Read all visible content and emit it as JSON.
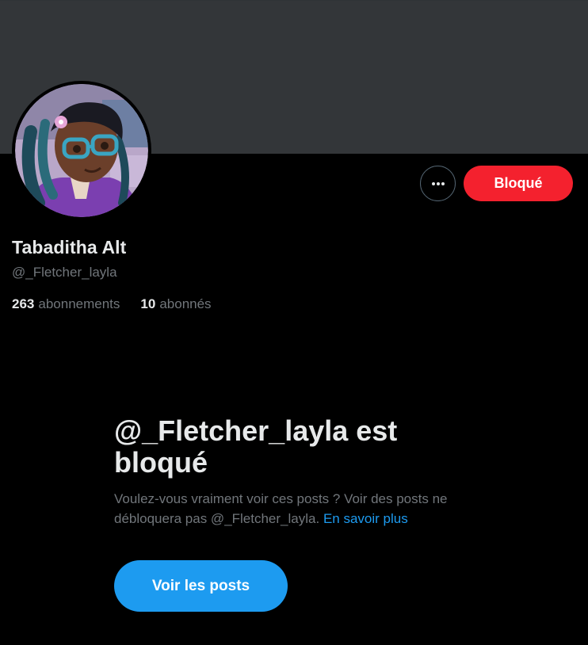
{
  "profile": {
    "display_name": "Tabaditha Alt",
    "handle": "@_Fletcher_layla",
    "following_count": "263",
    "following_label": "abonnements",
    "followers_count": "10",
    "followers_label": "abonnés"
  },
  "actions": {
    "more_icon": "more-horizontal-icon",
    "blocked_label": "Bloqué"
  },
  "blocked_notice": {
    "title": "@_Fletcher_layla est bloqué",
    "description": "Voulez-vous vraiment voir ces posts ? Voir des posts ne débloquera pas @_Fletcher_layla.",
    "learn_more": "En savoir plus",
    "view_posts_label": "Voir les posts"
  },
  "colors": {
    "background": "#000000",
    "banner": "#333639",
    "blocked_button": "#f4212e",
    "accent": "#1d9bf0",
    "secondary_text": "#71767b"
  }
}
